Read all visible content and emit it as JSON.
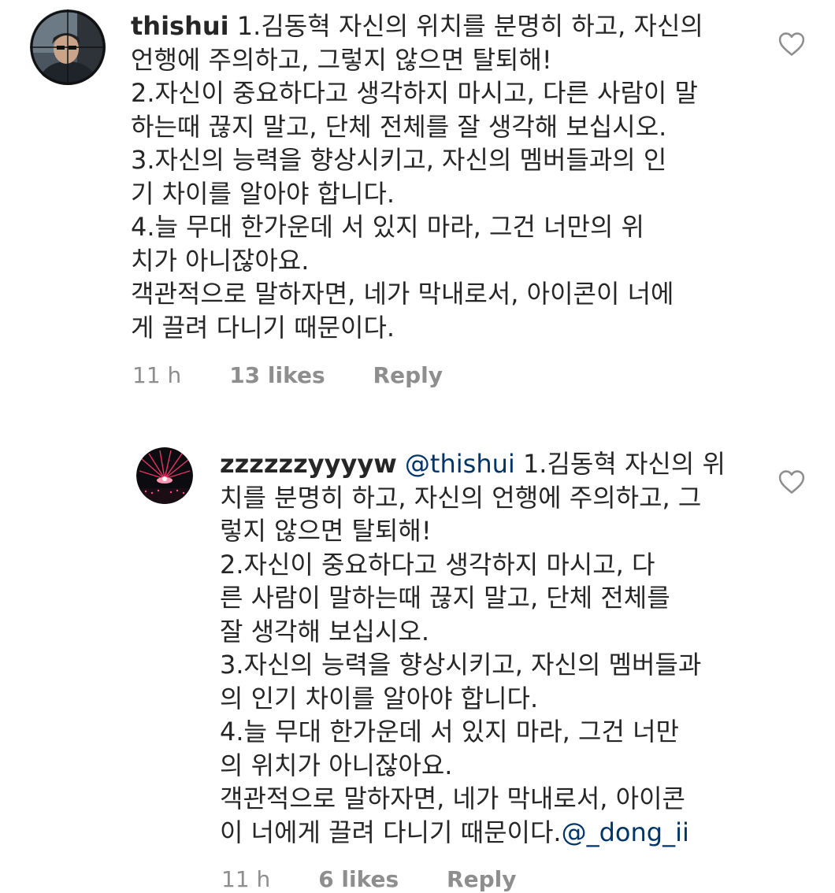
{
  "comments": [
    {
      "username": "thishui",
      "lines": [
        "1.김동혁 자신의 위치를 분명히 하고, 자신의",
        "언행에 주의하고, 그렇지 않으면 탈퇴해!",
        "2.자신이 중요하다고 생각하지 마시고, 다른 사람이 말",
        "하는때  끊지 말고, 단체 전체를 잘 생각해 보십시오.",
        "3.자신의 능력을 향상시키고, 자신의 멤버들과의 인",
        "기 차이를 알아야 합니다.",
        "4.늘 무대 한가운데 서 있지 마라, 그건 너만의 위",
        "치가 아니잖아요.",
        "객관적으로 말하자면, 네가 막내로서, 아이콘이 너에",
        "게 끌려 다니기 때문이다."
      ],
      "time": "11 h",
      "likes": "13 likes",
      "reply": "Reply",
      "avatar_icon": "profile-photo-crosshair"
    },
    {
      "username": "zzzzzzyyyyw",
      "mention": "@thishui",
      "lines": [
        "1.김동혁 자신의 위",
        "치를 분명히 하고, 자신의 언행에 주의하고, 그",
        "렇지 않으면 탈퇴해!",
        "2.자신이 중요하다고 생각하지 마시고, 다",
        "른 사람이 말하는때  끊지 말고, 단체 전체를",
        "잘 생각해 보십시오.",
        "3.자신의 능력을 향상시키고, 자신의 멤버들과",
        "의 인기 차이를 알아야 합니다.",
        "4.늘 무대 한가운데 서 있지 마라, 그건 너만",
        "의 위치가 아니잖아요.",
        "객관적으로 말하자면, 네가 막내로서, 아이콘",
        "이 너에게 끌려 다니기 때문이다."
      ],
      "end_mention": "@_dong_ii",
      "time": "11 h",
      "likes": "6 likes",
      "reply": "Reply",
      "avatar_icon": "concert-stage-photo"
    }
  ],
  "colors": {
    "text": "#262626",
    "meta": "#8e8e8e",
    "mention": "#003569",
    "heart": "#8e8e8e"
  }
}
